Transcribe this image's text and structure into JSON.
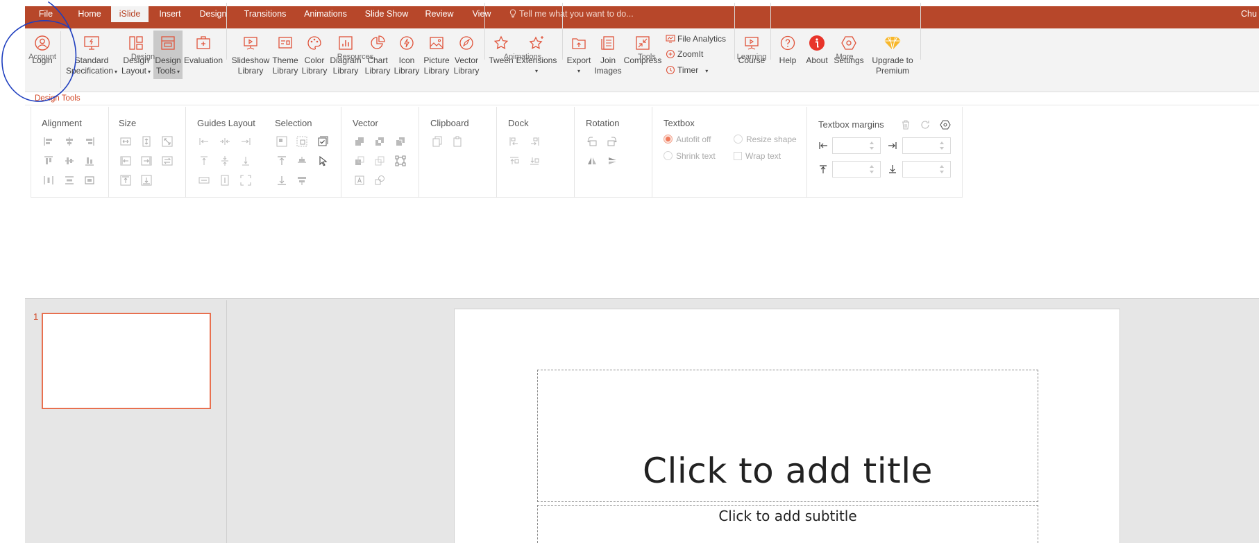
{
  "tabs": {
    "file": "File",
    "home": "Home",
    "islide": "iSlide",
    "insert": "Insert",
    "design": "Design",
    "transitions": "Transitions",
    "animations": "Animations",
    "slideshow": "Slide Show",
    "review": "Review",
    "view": "View"
  },
  "search": {
    "placeholder": "Tell me what you want to do..."
  },
  "user": {
    "name": "Chu"
  },
  "ribbon": {
    "login": "Login",
    "standard_spec_1": "Standard",
    "standard_spec_2": "Specification",
    "design_layout_1": "Design",
    "design_layout_2": "Layout",
    "design_tools_1": "Design",
    "design_tools_2": "Tools",
    "evaluation": "Evaluation",
    "slideshow_lib_1": "Slideshow",
    "slideshow_lib_2": "Library",
    "theme_lib_1": "Theme",
    "theme_lib_2": "Library",
    "color_lib_1": "Color",
    "color_lib_2": "Library",
    "diagram_lib_1": "Diagram",
    "diagram_lib_2": "Library",
    "chart_lib_1": "Chart",
    "chart_lib_2": "Library",
    "icon_lib_1": "Icon",
    "icon_lib_2": "Library",
    "picture_lib_1": "Picture",
    "picture_lib_2": "Library",
    "vector_lib_1": "Vector",
    "vector_lib_2": "Library",
    "tween": "Tween",
    "extensions": "Extensions",
    "export": "Export",
    "join_images_1": "Join",
    "join_images_2": "Images",
    "compress": "Compress",
    "file_analytics": "File Analytics",
    "zoomit": "ZoomIt",
    "timer": "Timer",
    "course": "Course",
    "help": "Help",
    "about": "About",
    "settings": "Settings",
    "upgrade_1": "Upgrade to",
    "upgrade_2": "Premium"
  },
  "groups": {
    "account": "Account",
    "design": "Design",
    "resources": "Resources",
    "animations": "Animations",
    "tools": "Tools",
    "learning": "Learning",
    "more": "More"
  },
  "design_tools_label": "Design Tools",
  "sections": {
    "alignment": "Alignment",
    "size": "Size",
    "guides_layout": "Guides Layout",
    "selection": "Selection",
    "vector": "Vector",
    "clipboard": "Clipboard",
    "dock": "Dock",
    "rotation": "Rotation",
    "textbox": "Textbox",
    "textbox_margins": "Textbox margins"
  },
  "textbox": {
    "autofit_off": "Autofit off",
    "resize_shape": "Resize shape",
    "shrink_text": "Shrink text",
    "wrap_text": "Wrap text"
  },
  "slides": {
    "current_number": "1"
  },
  "slide": {
    "title_placeholder": "Click to add title",
    "subtitle_placeholder": "Click to add subtitle"
  },
  "colors": {
    "accent": "#b7472a",
    "highlight": "#d24726",
    "annotation": "#1f3fbf"
  }
}
